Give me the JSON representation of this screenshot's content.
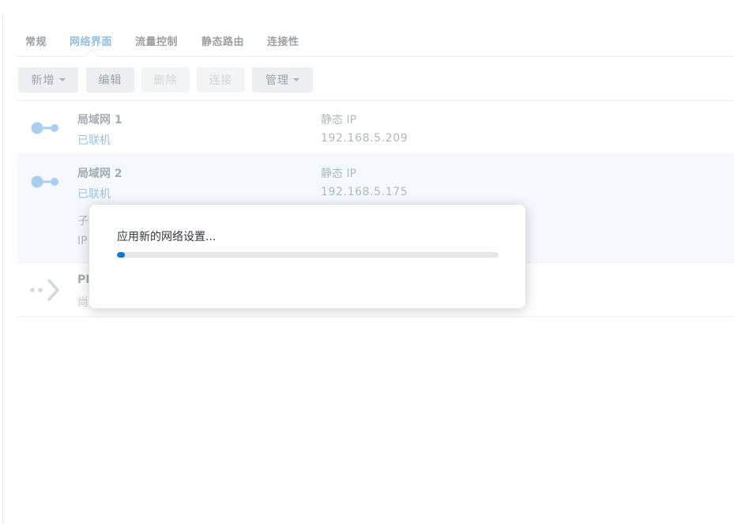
{
  "tabs": [
    {
      "label": "常规",
      "active": false
    },
    {
      "label": "网络界面",
      "active": true
    },
    {
      "label": "流量控制",
      "active": false
    },
    {
      "label": "静态路由",
      "active": false
    },
    {
      "label": "连接性",
      "active": false
    }
  ],
  "toolbar": {
    "create_label": "新增",
    "edit_label": "编辑",
    "delete_label": "删除",
    "connect_label": "连接",
    "manage_label": "管理"
  },
  "interfaces": [
    {
      "name": "局域网 1",
      "status": "已联机",
      "type": "静态 IP",
      "ip": "192.168.5.209",
      "icon": "lan-connected-icon"
    },
    {
      "name": "局域网 2",
      "status": "已联机",
      "type": "静态 IP",
      "ip": "192.168.5.175",
      "icon": "lan-connected-icon",
      "extra1": "子",
      "extra2": "IP"
    },
    {
      "name": "PI",
      "status": "尚",
      "icon": "pppoe-disconnected-icon"
    }
  ],
  "dialog": {
    "message": "应用新的网络设置...",
    "progress": 0.02
  },
  "colors": {
    "accent": "#8fbde8",
    "progress": "#0b7ad6",
    "connected": "#94c3ec"
  }
}
